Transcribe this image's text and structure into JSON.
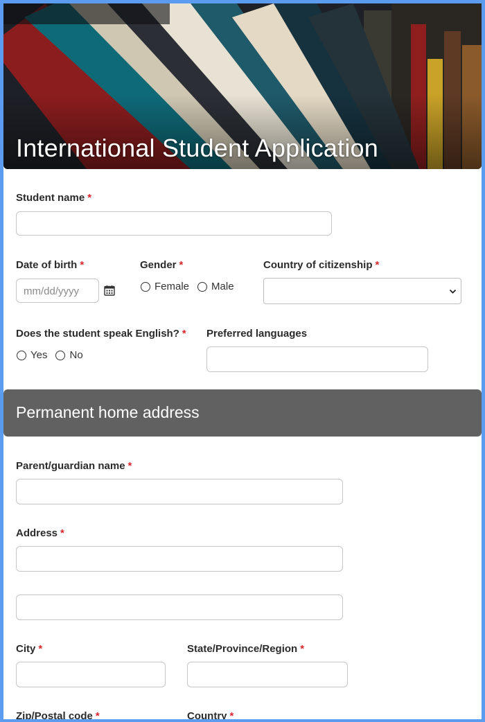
{
  "header": {
    "title": "International Student Application"
  },
  "fields": {
    "student_name": {
      "label": "Student name",
      "required": "*"
    },
    "date_of_birth": {
      "label": "Date of birth",
      "required": "*",
      "placeholder": "mm/dd/yyyy"
    },
    "gender": {
      "label": "Gender",
      "required": "*",
      "options": [
        "Female",
        "Male"
      ]
    },
    "country_citizenship": {
      "label": "Country of citizenship",
      "required": "*",
      "selected": ""
    },
    "speaks_english": {
      "label": "Does the student speak English?",
      "required": "*",
      "options": [
        "Yes",
        "No"
      ]
    },
    "preferred_languages": {
      "label": "Preferred languages"
    }
  },
  "section": {
    "title": "Permanent home address"
  },
  "address_fields": {
    "guardian_name": {
      "label": "Parent/guardian name",
      "required": "*"
    },
    "address": {
      "label": "Address",
      "required": "*"
    },
    "city": {
      "label": "City",
      "required": "*"
    },
    "state": {
      "label": "State/Province/Region",
      "required": "*"
    },
    "zip": {
      "label": "Zip/Postal code",
      "required": "*"
    },
    "country": {
      "label": "Country",
      "required": "*"
    }
  },
  "colors": {
    "page_border": "#5b9cf0",
    "required": "#d9262c",
    "section_bar": "#616161"
  }
}
